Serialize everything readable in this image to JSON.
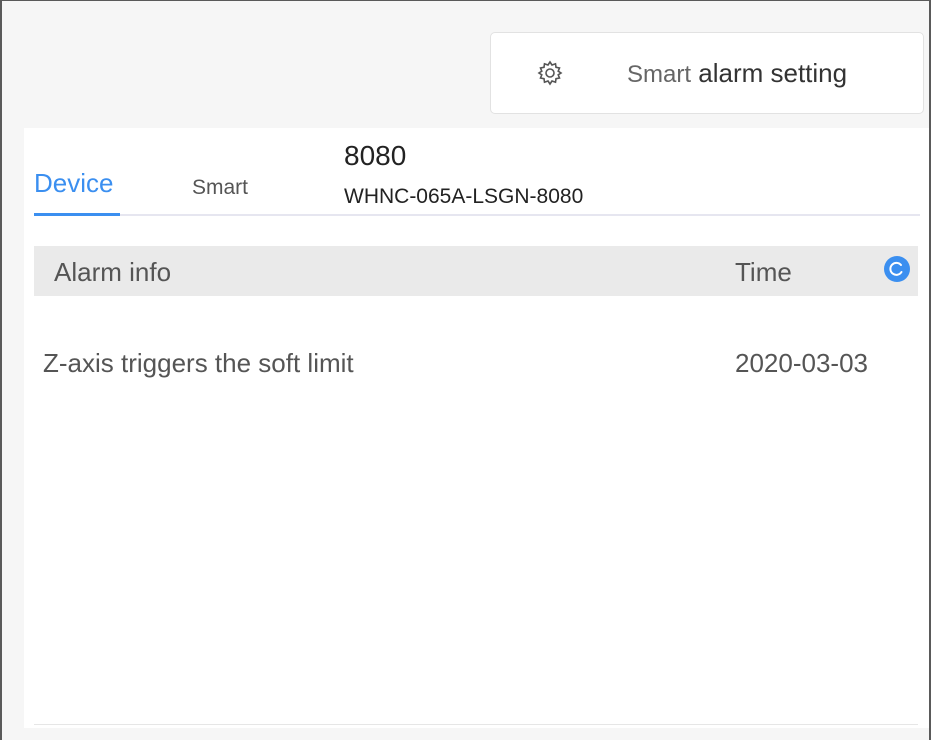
{
  "header": {
    "smart_alarm_setting": {
      "prefix": "Smart",
      "label": "alarm setting",
      "icon": "gear-icon"
    }
  },
  "tabs": [
    {
      "label": "Device",
      "active": true
    },
    {
      "label": "Smart",
      "active": false
    }
  ],
  "device": {
    "title": "8080",
    "subtitle": "WHNC-065A-LSGN-8080"
  },
  "table": {
    "columns": [
      "Alarm info",
      "Time"
    ],
    "refresh_icon": "refresh-icon",
    "rows": [
      {
        "alarm_info": "Z-axis triggers the soft limit",
        "time": "2020-03-03"
      }
    ]
  },
  "colors": {
    "accent": "#3b8ff0",
    "header_bg": "#eaeaea",
    "page_bg": "#f6f6f6"
  }
}
